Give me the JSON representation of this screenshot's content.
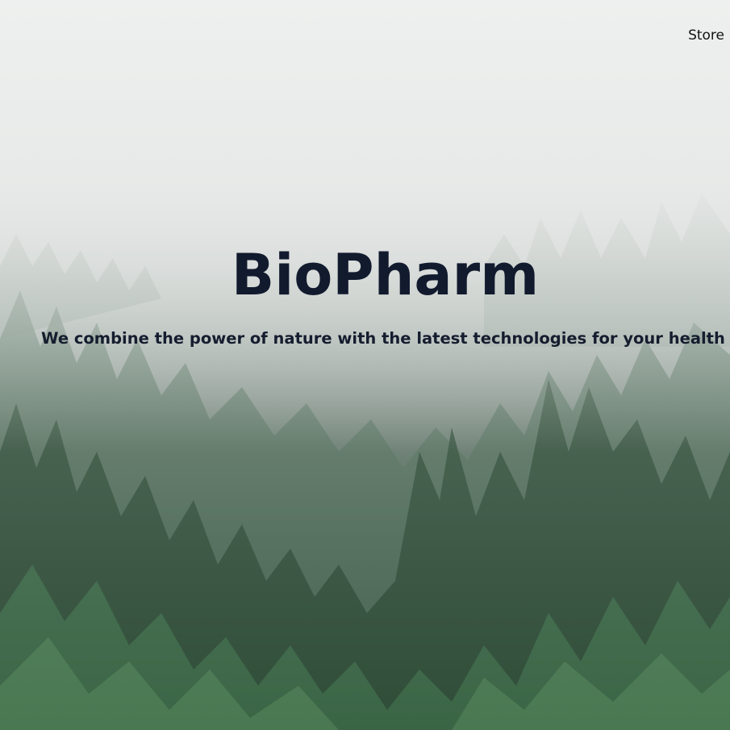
{
  "nav": {
    "store_label": "Store"
  },
  "hero": {
    "title": "BioPharm",
    "tagline": "We combine the power of nature with the latest technologies for your health"
  },
  "background": {
    "description_icon": "misty-forest-image",
    "fog_color": "#eceeed",
    "forest_color": "#2f4d38"
  }
}
